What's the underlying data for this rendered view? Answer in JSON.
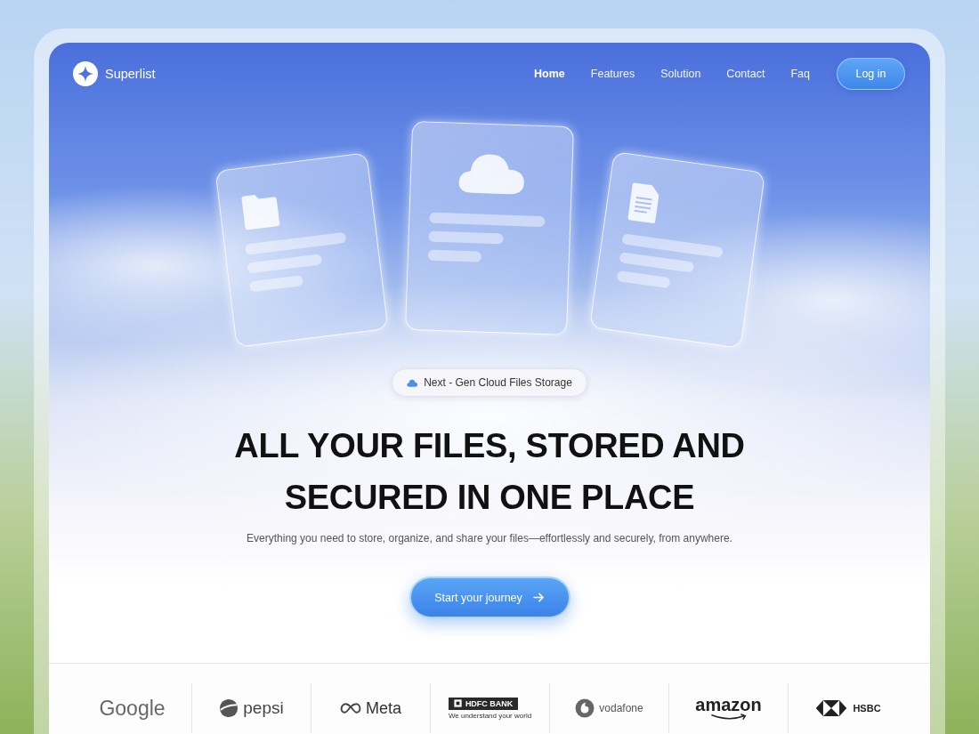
{
  "brand": {
    "name": "Superlist"
  },
  "nav": [
    {
      "label": "Home",
      "selected": true
    },
    {
      "label": "Features",
      "selected": false
    },
    {
      "label": "Solution",
      "selected": false
    },
    {
      "label": "Contact",
      "selected": false
    },
    {
      "label": "Faq",
      "selected": false
    }
  ],
  "login": {
    "label": "Log in"
  },
  "cards": [
    {
      "kind": "folder"
    },
    {
      "kind": "cloud"
    },
    {
      "kind": "document"
    }
  ],
  "badge": {
    "label": "Next - Gen Cloud Files Storage"
  },
  "headline": "ALL YOUR FILES, STORED AND SECURED IN ONE PLACE",
  "subtitle": "Everything you need to store, organize, and share your files—effortlessly and securely, from anywhere.",
  "cta": {
    "label": "Start your journey"
  },
  "logos": [
    {
      "kind": "google",
      "name": "Google"
    },
    {
      "kind": "pepsi",
      "name": "pepsi"
    },
    {
      "kind": "meta",
      "name": "Meta"
    },
    {
      "kind": "hdfc",
      "name": "HDFC BANK",
      "tagline": "We understand your world"
    },
    {
      "kind": "vodafone",
      "name": "vodafone"
    },
    {
      "kind": "amazon",
      "name": "amazon"
    },
    {
      "kind": "hsbc",
      "name": "HSBC"
    }
  ]
}
